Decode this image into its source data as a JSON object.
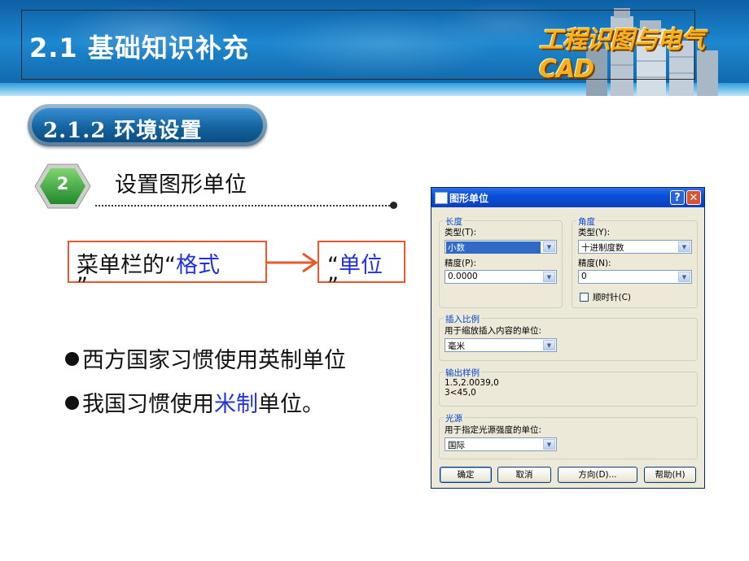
{
  "header": {
    "title": "2.1  基础知识补充",
    "brand": "工程识图与电气CAD"
  },
  "section": {
    "label": "2.1.2  环境设置"
  },
  "step": {
    "number": "2",
    "title": "设置图形单位"
  },
  "menu_path": {
    "prefix": "菜单栏的“",
    "format": "格式",
    "close_quote_1": "”",
    "open_quote_2": "“",
    "units": "单位",
    "close_quote_2": "”"
  },
  "bullets": [
    {
      "parts": [
        "西方国家习惯使用英制单位"
      ]
    },
    {
      "before": "我国习惯使用",
      "highlight": "米制",
      "after": "单位。"
    }
  ],
  "dialog": {
    "title": "图形单位",
    "help_label": "?",
    "close_label": "✕",
    "length": {
      "group_title": "长度",
      "type_label": "类型(T):",
      "type_value": "小数",
      "precision_label": "精度(P):",
      "precision_value": "0.0000"
    },
    "angle": {
      "group_title": "角度",
      "type_label": "类型(Y):",
      "type_value": "十进制度数",
      "precision_label": "精度(N):",
      "precision_value": "0",
      "clockwise_label": "顺时针(C)",
      "clockwise_checked": false
    },
    "insertion": {
      "group_title": "插入比例",
      "desc": "用于缩放插入内容的单位:",
      "value": "毫米"
    },
    "sample": {
      "group_title": "输出样例",
      "line1": "1.5,2.0039,0",
      "line2": "3<45,0"
    },
    "lighting": {
      "group_title": "光源",
      "desc": "用于指定光源强度的单位:",
      "value": "国际"
    },
    "buttons": {
      "ok": "确定",
      "cancel": "取消",
      "direction": "方向(D)...",
      "help": "帮助(H)"
    }
  },
  "colors": {
    "accent_blue": "#2233dd",
    "box_border": "#e8582a",
    "header_blue": "#1d87cf",
    "badge_green": "#3aa83a"
  }
}
